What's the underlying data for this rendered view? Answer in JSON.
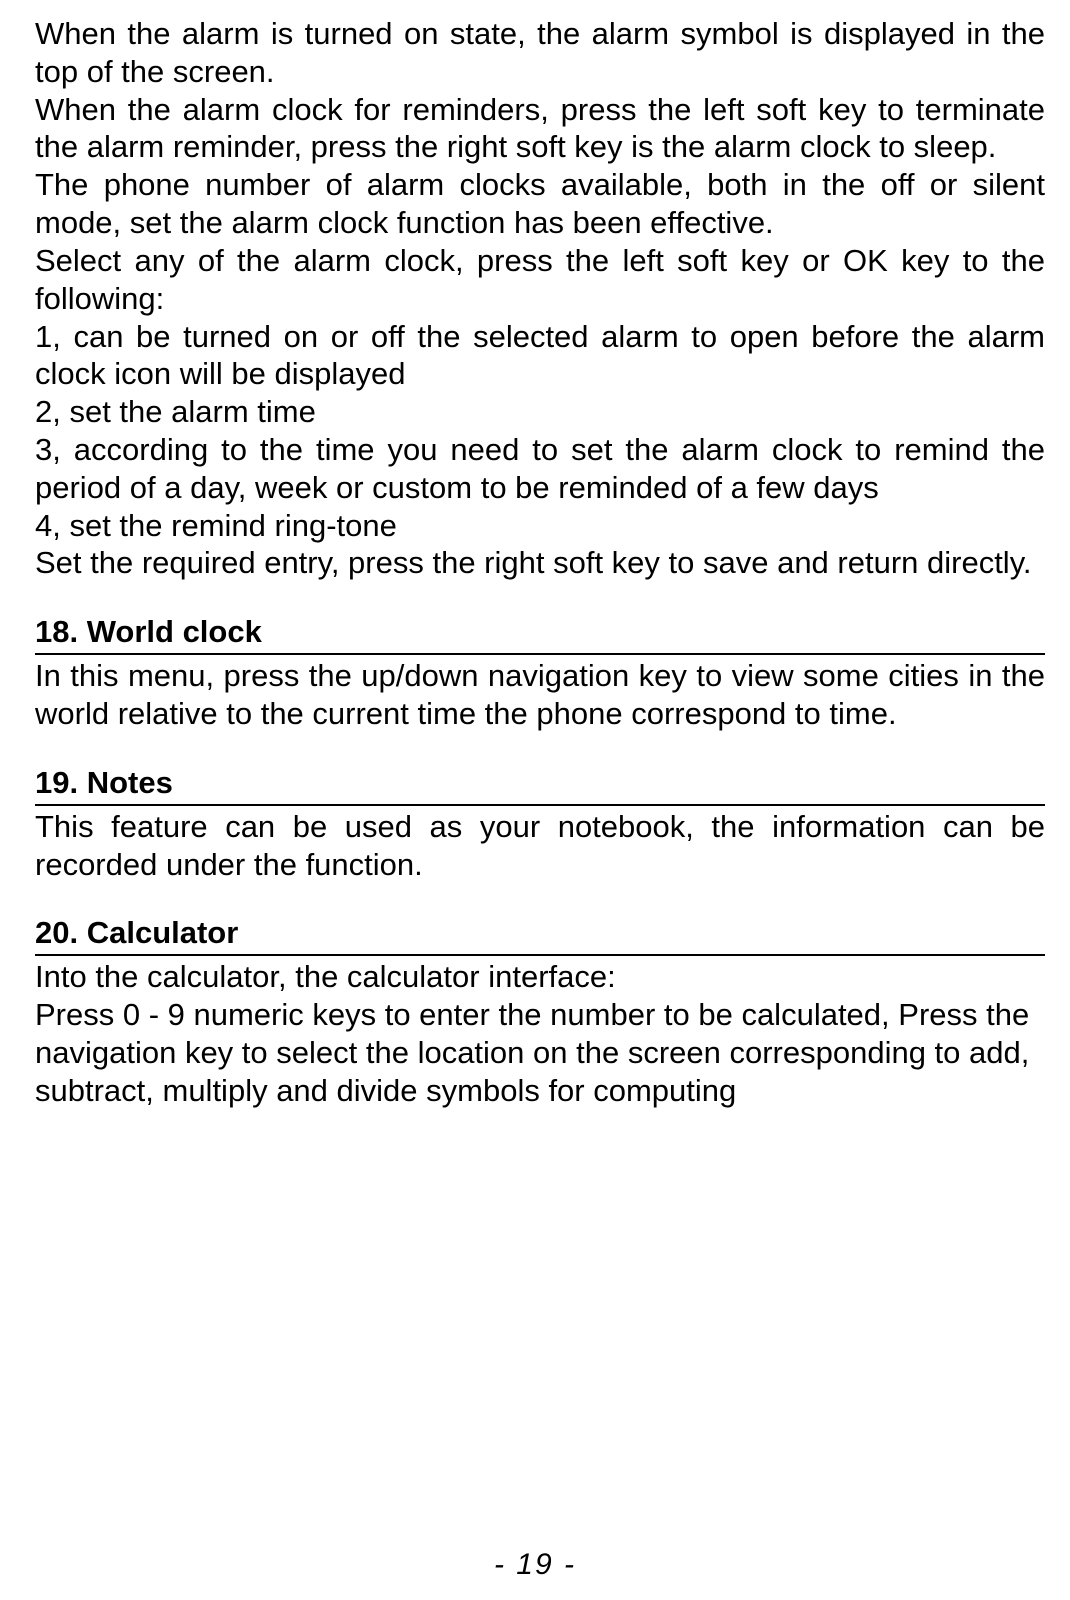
{
  "p1": "When the alarm is turned on state, the alarm symbol is displayed in the top of the screen.",
  "p2": "When the alarm clock for reminders, press the left soft key to terminate the alarm reminder, press the right soft key is the alarm clock to sleep.",
  "p3": "The phone number of alarm clocks available, both in the off or silent mode, set the alarm clock function has been effective.",
  "p4": "Select any of the alarm clock, press the left soft key or OK key to the following:",
  "p5": "1, can be turned on or off the selected alarm to open before the alarm clock icon will be displayed",
  "p6": "2, set the alarm time",
  "p7": "3, according to the time you need to set the alarm clock to remind the period of a day, week or custom to be reminded of a few days",
  "p8": "4, set the remind ring-tone",
  "p9": "Set the required entry, press the right soft key to save and return directly.",
  "h18": "18. World clock",
  "p10": "In this menu, press the up/down navigation key to view some cities in the world relative to the current time the phone correspond to time.",
  "h19": "19. Notes",
  "p11": "This feature can be used as your notebook, the information can be recorded under the function.",
  "h20": "20. Calculator",
  "p12": "Into the calculator, the calculator interface:",
  "p13": "Press 0 - 9 numeric keys to enter the number to be calculated, Press the navigation key to select the location on the screen corresponding to add, subtract, multiply and divide symbols for computing",
  "pagenum": "- 19 -"
}
